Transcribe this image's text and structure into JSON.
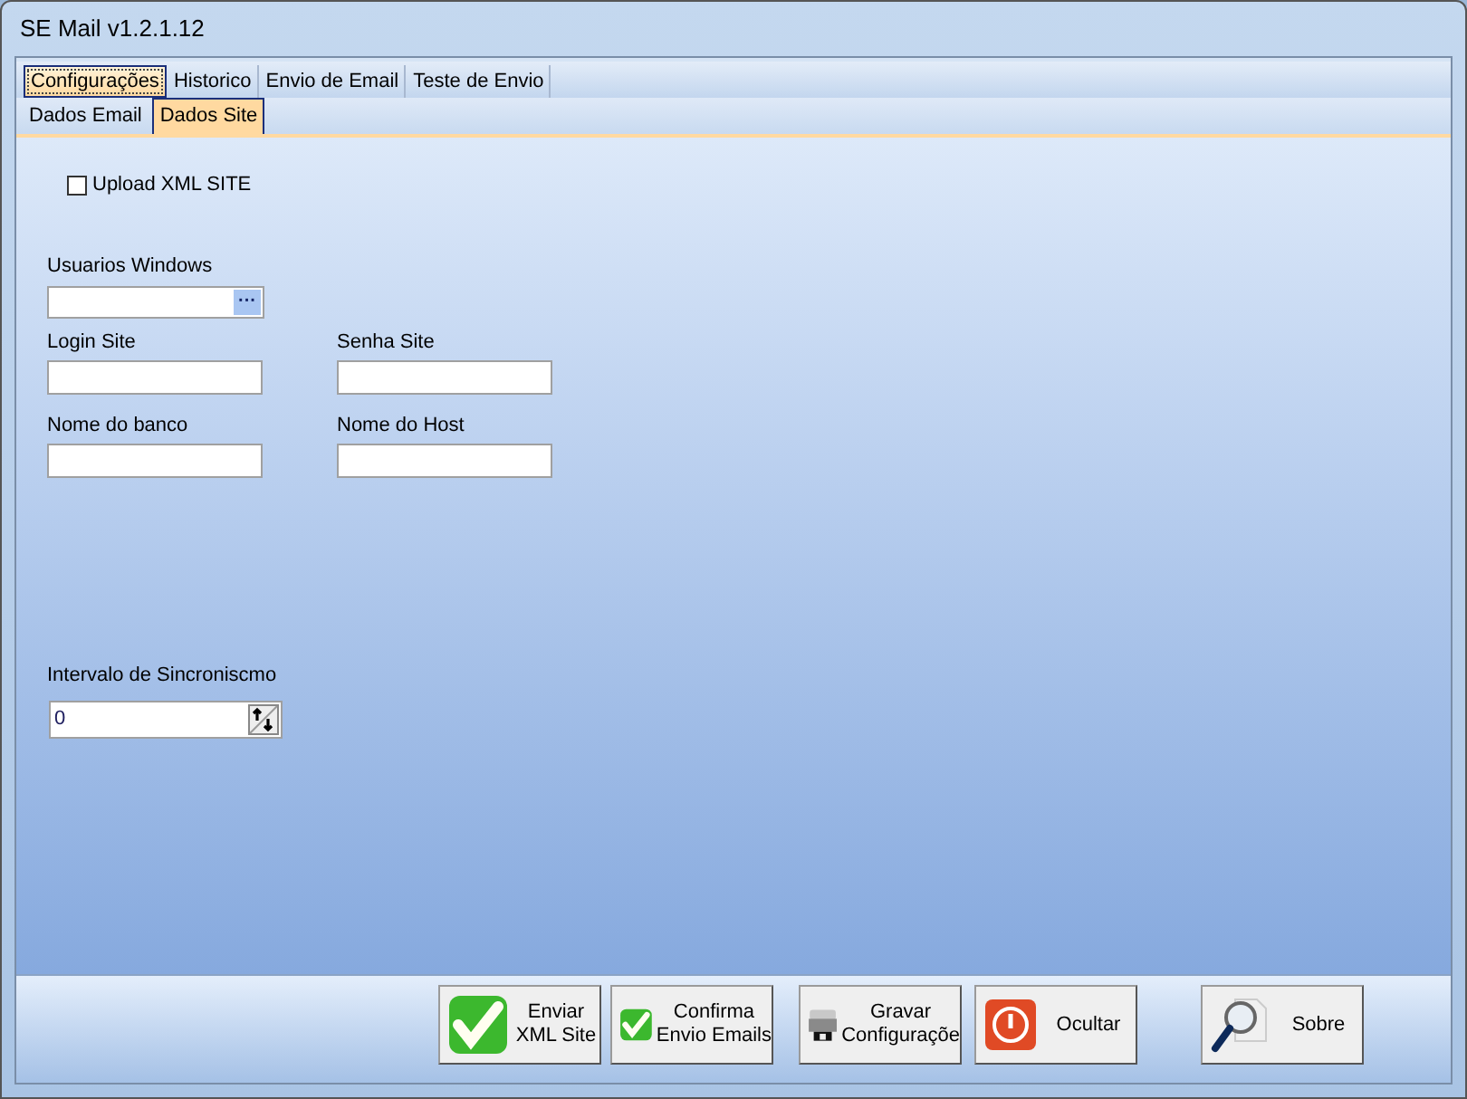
{
  "window": {
    "title": "SE Mail v1.2.1.12"
  },
  "tabs": [
    {
      "label": "Configurações",
      "selected": true
    },
    {
      "label": "Historico",
      "selected": false
    },
    {
      "label": "Envio de Email",
      "selected": false
    },
    {
      "label": "Teste de Envio",
      "selected": false
    }
  ],
  "subtabs": [
    {
      "label": "Dados Email",
      "selected": false
    },
    {
      "label": "Dados Site",
      "selected": true
    }
  ],
  "upload_checkbox": {
    "label": "Upload XML SITE",
    "checked": false
  },
  "usuarios_windows": {
    "label": "Usuarios Windows",
    "browse": "···"
  },
  "fields": [
    {
      "label": "Login Site"
    },
    {
      "label": "Senha Site"
    },
    {
      "label": "Nome do banco"
    },
    {
      "label": "Nome do Host"
    }
  ],
  "intervalo": {
    "label": "Intervalo de Sincroniscmo",
    "value": "0"
  },
  "buttons": [
    {
      "kind": "check",
      "lines": [
        "Enviar",
        "XML Site"
      ]
    },
    {
      "kind": "check",
      "lines": [
        "Confirma",
        "Envio Emails"
      ]
    },
    {
      "kind": "printer",
      "lines": [
        "Gravar",
        "Configuraçõe"
      ]
    },
    {
      "kind": "power",
      "lines": [
        "Ocultar"
      ]
    },
    {
      "kind": "search",
      "lines": [
        "Sobre"
      ]
    }
  ]
}
